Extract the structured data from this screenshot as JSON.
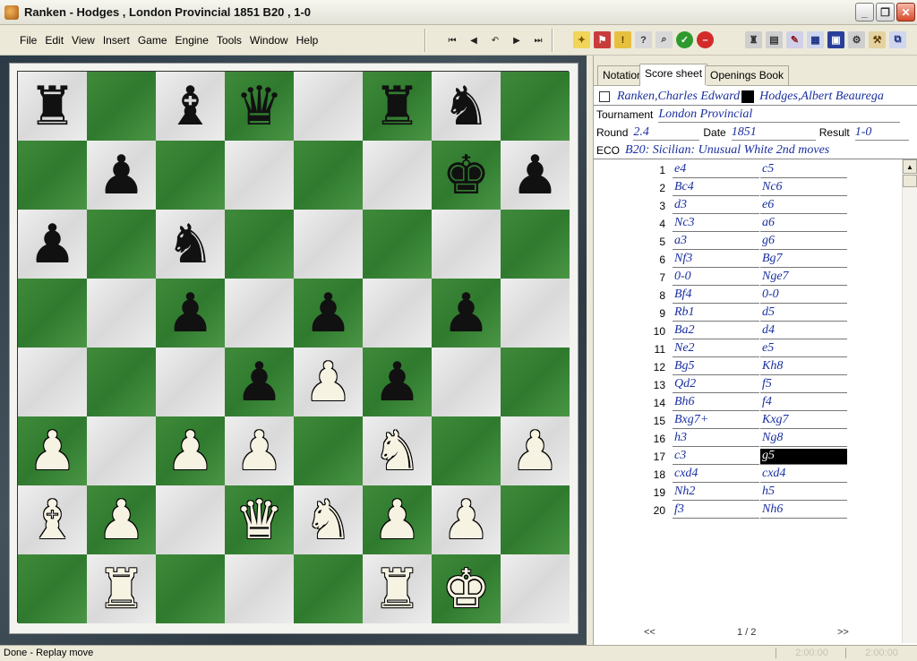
{
  "window": {
    "title": "Ranken - Hodges , London Provincial 1851  B20 , 1-0",
    "minimize": "_",
    "restore": "❐",
    "close": "✕"
  },
  "menu": [
    "File",
    "Edit",
    "View",
    "Insert",
    "Game",
    "Engine",
    "Tools",
    "Window",
    "Help"
  ],
  "nav_icons": [
    "first-move-icon",
    "previous-move-icon",
    "undo-icon",
    "next-move-icon",
    "last-move-icon"
  ],
  "tool_icons": [
    "new-icon",
    "flag-icon",
    "warning-icon",
    "question-icon",
    "search-icon",
    "check-icon",
    "stop-icon",
    "rook-icon",
    "book-icon",
    "pen-icon",
    "board-icon",
    "window-icon",
    "wrench-icon",
    "layout-icon"
  ],
  "board": {
    "rows": [
      [
        "r",
        "",
        "b",
        "q",
        "",
        "r",
        "n",
        ""
      ],
      [
        "",
        "p",
        "",
        "",
        "",
        "",
        "k",
        "p"
      ],
      [
        "p",
        "",
        "n",
        "",
        "",
        "",
        "",
        ""
      ],
      [
        "",
        "",
        "p",
        "",
        "p",
        "",
        "p",
        ""
      ],
      [
        "",
        "",
        "",
        "p",
        "P",
        "p",
        "",
        ""
      ],
      [
        "P",
        "",
        "P",
        "P",
        "",
        "N",
        "",
        "P"
      ],
      [
        "B",
        "P",
        "",
        "Q",
        "N",
        "P",
        "P",
        ""
      ],
      [
        "",
        "R",
        "",
        "",
        "",
        "R",
        "K",
        ""
      ]
    ]
  },
  "tabs": [
    "Notation",
    "Score sheet",
    "Openings Book"
  ],
  "game": {
    "white": "Ranken,Charles Edward",
    "black": "Hodges,Albert Beaurega",
    "tournament_label": "Tournament",
    "tournament": "London Provincial",
    "round_label": "Round",
    "round": "2.4",
    "date_label": "Date",
    "date": "1851",
    "result_label": "Result",
    "result": "1-0",
    "eco_label": "ECO",
    "eco": "B20: Sicilian: Unusual White 2nd moves"
  },
  "moves": [
    {
      "n": "1",
      "w": "e4",
      "b": "c5"
    },
    {
      "n": "2",
      "w": "Bc4",
      "b": "Nc6"
    },
    {
      "n": "3",
      "w": "d3",
      "b": "e6"
    },
    {
      "n": "4",
      "w": "Nc3",
      "b": "a6"
    },
    {
      "n": "5",
      "w": "a3",
      "b": "g6"
    },
    {
      "n": "6",
      "w": "Nf3",
      "b": "Bg7"
    },
    {
      "n": "7",
      "w": "0-0",
      "b": "Nge7"
    },
    {
      "n": "8",
      "w": "Bf4",
      "b": "0-0"
    },
    {
      "n": "9",
      "w": "Rb1",
      "b": "d5"
    },
    {
      "n": "10",
      "w": "Ba2",
      "b": "d4"
    },
    {
      "n": "11",
      "w": "Ne2",
      "b": "e5"
    },
    {
      "n": "12",
      "w": "Bg5",
      "b": "Kh8"
    },
    {
      "n": "13",
      "w": "Qd2",
      "b": "f5"
    },
    {
      "n": "14",
      "w": "Bh6",
      "b": "f4"
    },
    {
      "n": "15",
      "w": "Bxg7+",
      "b": "Kxg7"
    },
    {
      "n": "16",
      "w": "h3",
      "b": "Ng8"
    },
    {
      "n": "17",
      "w": "c3",
      "b": "g5"
    },
    {
      "n": "18",
      "w": "cxd4",
      "b": "cxd4"
    },
    {
      "n": "19",
      "w": "Nh2",
      "b": "h5"
    },
    {
      "n": "20",
      "w": "f3",
      "b": "Nh6"
    }
  ],
  "selected_move": {
    "number": "17",
    "side": "black"
  },
  "pager": {
    "prev": "<<",
    "page": "1 / 2",
    "next": ">>"
  },
  "status": {
    "text": "Done - Replay move",
    "clock_white": "2:00:00",
    "clock_black": "2:00:00"
  },
  "colors": {
    "move_text": "#1a2fa0",
    "dark_square": "#2f7a2e",
    "light_square": "#e4e4e4"
  }
}
